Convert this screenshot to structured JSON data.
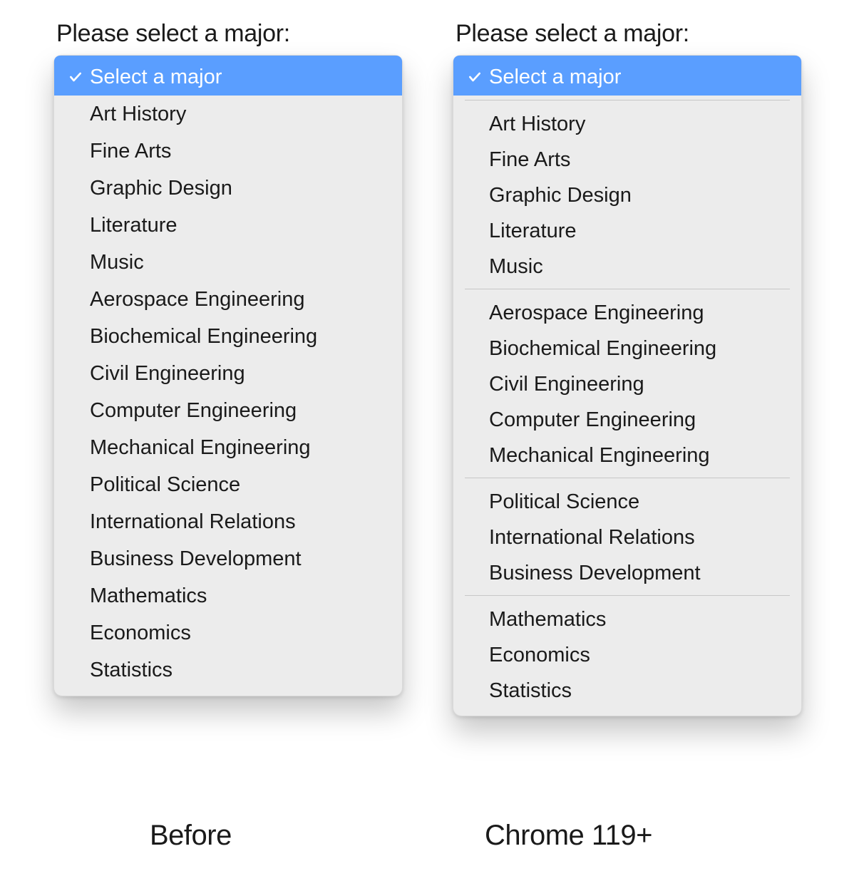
{
  "prompt_label": "Please select a major:",
  "selected_label": "Select a major",
  "captions": {
    "before": "Before",
    "after": "Chrome 119+"
  },
  "before": {
    "items": [
      "Art History",
      "Fine Arts",
      "Graphic Design",
      "Literature",
      "Music",
      "Aerospace Engineering",
      "Biochemical Engineering",
      "Civil Engineering",
      "Computer Engineering",
      "Mechanical Engineering",
      "Political Science",
      "International Relations",
      "Business Development",
      "Mathematics",
      "Economics",
      "Statistics"
    ]
  },
  "after": {
    "groups": [
      [
        "Art History",
        "Fine Arts",
        "Graphic Design",
        "Literature",
        "Music"
      ],
      [
        "Aerospace Engineering",
        "Biochemical Engineering",
        "Civil Engineering",
        "Computer Engineering",
        "Mechanical Engineering"
      ],
      [
        "Political Science",
        "International Relations",
        "Business Development"
      ],
      [
        "Mathematics",
        "Economics",
        "Statistics"
      ]
    ]
  }
}
